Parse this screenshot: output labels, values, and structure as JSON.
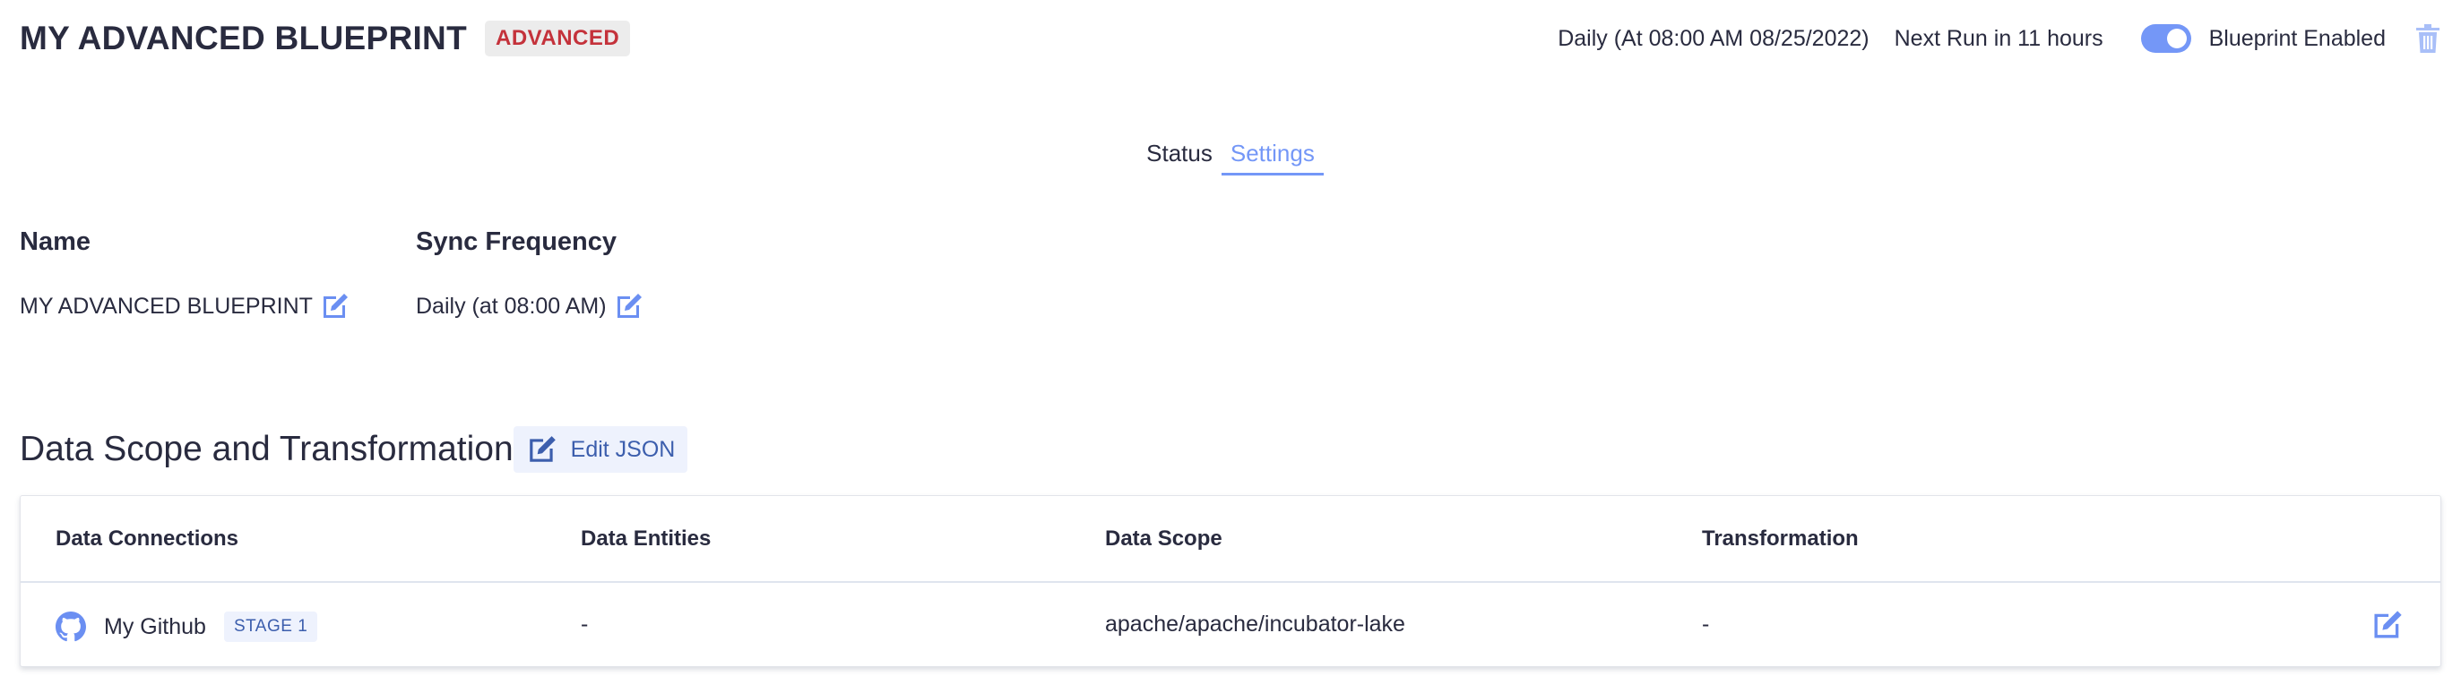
{
  "header": {
    "title": "MY ADVANCED BLUEPRINT",
    "mode_badge": "ADVANCED",
    "schedule": "Daily (At 08:00 AM 08/25/2022)",
    "next_run": "Next Run in 11 hours",
    "enabled_label": "Blueprint Enabled",
    "enabled": true,
    "delete_icon": "trash-icon"
  },
  "tabs": [
    {
      "label": "Status",
      "active": false
    },
    {
      "label": "Settings",
      "active": true
    }
  ],
  "settings": {
    "name_label": "Name",
    "name_value": "MY ADVANCED BLUEPRINT",
    "sync_label": "Sync Frequency",
    "sync_value": "Daily (at 08:00 AM)",
    "edit_icon": "edit-icon"
  },
  "data_scope": {
    "title": "Data Scope and Transformation",
    "edit_json_label": "Edit JSON",
    "columns": [
      "Data Connections",
      "Data Entities",
      "Data Scope",
      "Transformation"
    ],
    "rows": [
      {
        "connection": "My Github",
        "connection_icon": "github-icon",
        "stage": "STAGE 1",
        "entities": "-",
        "scope": "apache/apache/incubator-lake",
        "transformation": "-"
      }
    ]
  },
  "colors": {
    "accent": "#7497f7",
    "badge_text": "#c4323b",
    "tag_bg": "#eef2fd",
    "tag_text": "#3c5ead"
  }
}
